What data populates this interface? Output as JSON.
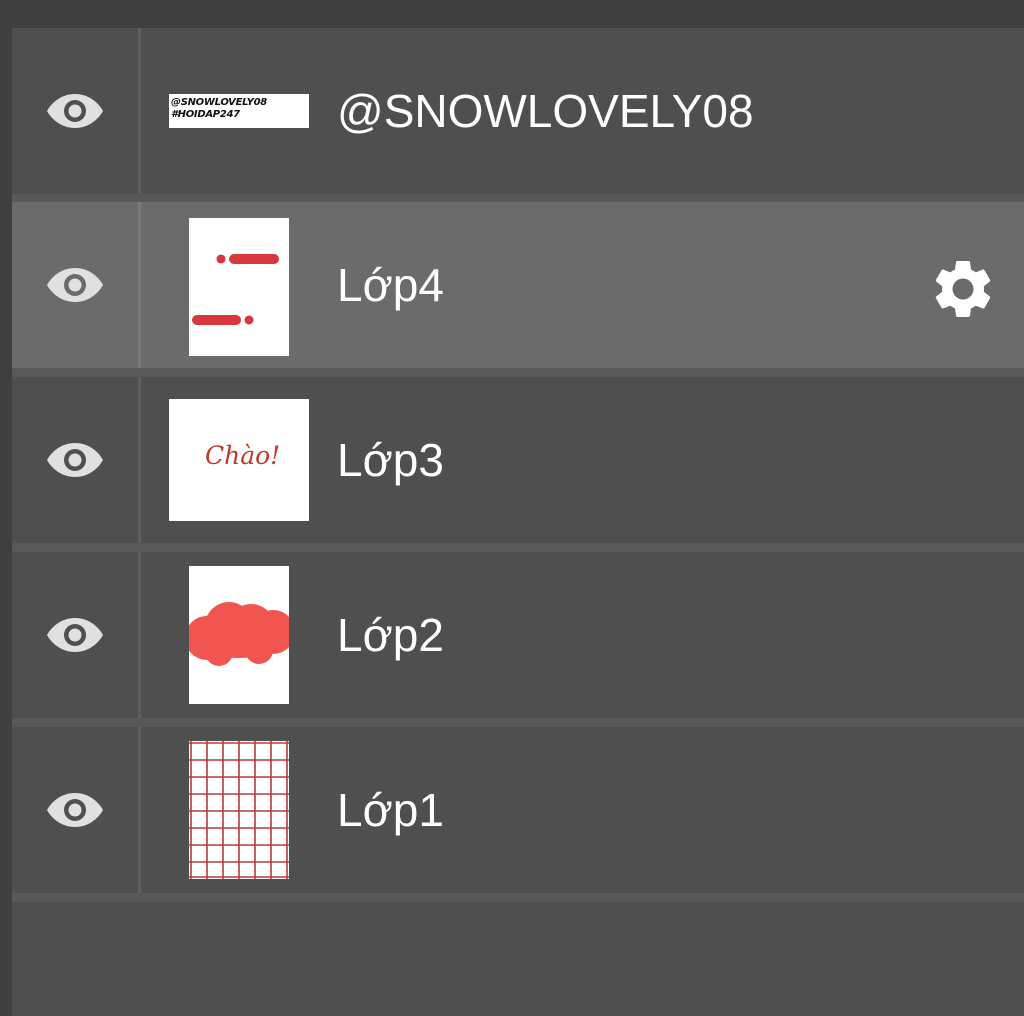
{
  "layers_panel": {
    "layers": [
      {
        "name": "@SNOWLOVELY08",
        "visible": true,
        "selected": false,
        "thumbnail_text": [
          "@SNOWLOVELY08",
          "#HOIDAP247"
        ]
      },
      {
        "name": "Lớp4",
        "visible": true,
        "selected": true
      },
      {
        "name": "Lớp3",
        "visible": true,
        "selected": false,
        "thumbnail_text": [
          "Chào!"
        ]
      },
      {
        "name": "Lớp2",
        "visible": true,
        "selected": false
      },
      {
        "name": "Lớp1",
        "visible": true,
        "selected": false
      }
    ],
    "icons": {
      "visibility": "eye-icon",
      "layer_settings": "gear-icon"
    },
    "colors": {
      "panel_background": "#4f4f4f",
      "selected_row": "#6b6b6b",
      "text": "#ffffff",
      "icon": "#e0e0e0",
      "thumbnail_accent": "#d9363e"
    }
  }
}
